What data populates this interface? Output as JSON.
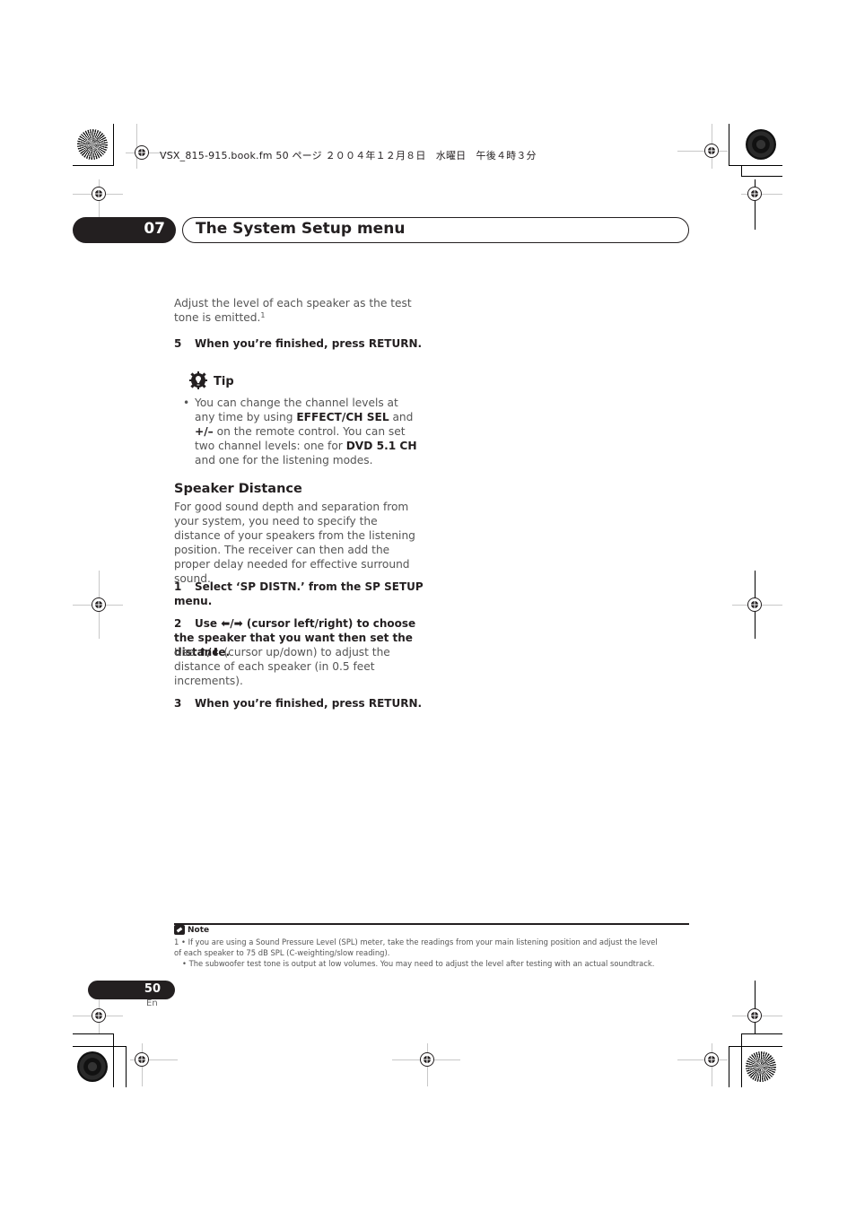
{
  "header": {
    "file_info": "VSX_815-915.book.fm  50 ページ  ２００４年１２月８日　水曜日　午後４時３分"
  },
  "chapter": {
    "number": "07",
    "title": "The System Setup menu"
  },
  "content": {
    "intro_text": "Adjust the level of each speaker as the test tone is emitted.",
    "intro_footnote_ref": "1",
    "step5": {
      "num": "5",
      "text": "When you’re finished, press RETURN."
    },
    "tip": {
      "label": "Tip",
      "icon": "lightbulb-gear-icon",
      "bullet": "•",
      "parts": {
        "a": "You can change the channel levels at any time by using ",
        "b_bold": "EFFECT/CH SEL",
        "c": " and ",
        "d_bold": "+/–",
        "e": " on the remote control. You can set two channel levels: one for ",
        "f_bold": "DVD 5.1 CH",
        "g": " and one for the listening modes."
      }
    },
    "section": {
      "heading": "Speaker Distance",
      "paragraph": "For good sound depth and separation from your system, you need to specify the distance of your speakers from the listening position. The receiver can then add the proper delay needed for effective surround sound.",
      "step1": {
        "num": "1",
        "text": "Select ‘SP DISTN.’ from the SP SETUP menu."
      },
      "step2": {
        "num": "2",
        "pre": "Use ",
        "arrows": "⬅/➡",
        "post": " (cursor left/right) to choose the speaker that you want then set the distance."
      },
      "step2_detail": {
        "pre": "Use ",
        "arrows": "⬆/⬇",
        "post": " (cursor up/down) to adjust the distance of each speaker (in 0.5 feet increments)."
      },
      "step3": {
        "num": "3",
        "text": "When you’re finished, press RETURN."
      }
    }
  },
  "note": {
    "label": "Note",
    "icon": "pencil-note-icon",
    "line1": "1  • If you are using a Sound Pressure Level (SPL) meter, take the readings from your main listening position and adjust the level",
    "line1b": "of each speaker to 75 dB SPL (C-weighting/slow reading).",
    "line2": "• The subwoofer test tone is output at low volumes. You may need to adjust the level after testing with an actual soundtrack."
  },
  "footer": {
    "page_number": "50",
    "language": "En"
  }
}
